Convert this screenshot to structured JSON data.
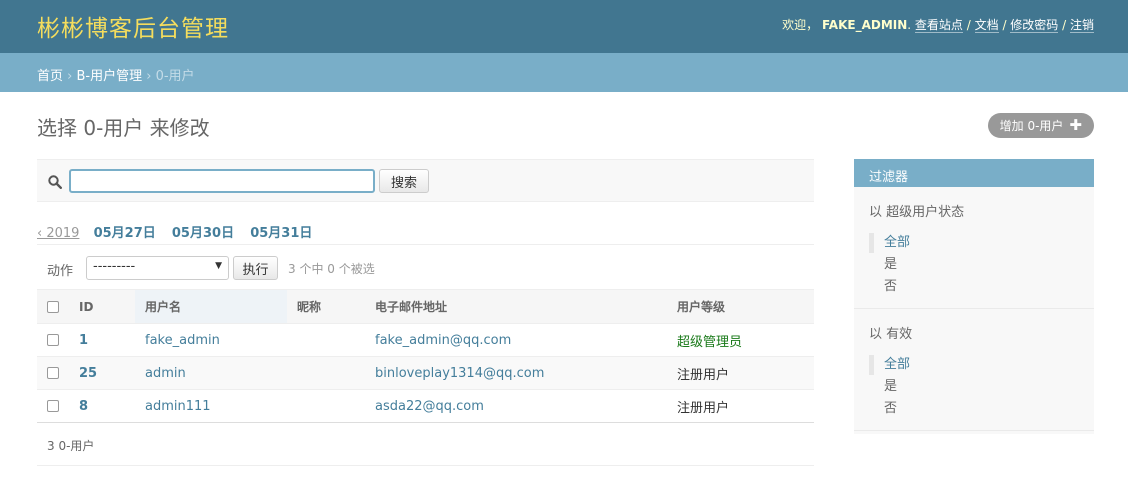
{
  "header": {
    "site_name": "彬彬博客后台管理",
    "welcome": "欢迎，",
    "username": "FAKE_ADMIN",
    "view_site": "查看站点",
    "docs": "文档",
    "change_password": "修改密码",
    "logout": "注销",
    "separator": " / "
  },
  "breadcrumbs": {
    "home": "首页",
    "app": "B-用户管理",
    "current": "0-用户",
    "sep": " › "
  },
  "page": {
    "title": "选择 0-用户 来修改",
    "add_label": "增加 0-用户",
    "add_icon": "plus-icon"
  },
  "search": {
    "value": "",
    "button": "搜索",
    "icon": "search-icon"
  },
  "date_hierarchy": {
    "back": "‹ 2019",
    "dates": [
      "05月27日",
      "05月30日",
      "05月31日"
    ]
  },
  "actions": {
    "label": "动作",
    "selected": "---------",
    "go": "执行",
    "counter": "3 个中 0 个被选"
  },
  "table": {
    "headers": [
      "ID",
      "用户名",
      "昵称",
      "电子邮件地址",
      "用户等级"
    ],
    "rows": [
      {
        "id": "1",
        "username": "fake_admin",
        "nickname": "",
        "email": "fake_admin@qq.com",
        "level": "超级管理员"
      },
      {
        "id": "25",
        "username": "admin",
        "nickname": "",
        "email": "binloveplay1314@qq.com",
        "level": "注册用户"
      },
      {
        "id": "8",
        "username": "admin111",
        "nickname": "",
        "email": "asda22@qq.com",
        "level": "注册用户"
      }
    ]
  },
  "paginator": "3 0-用户",
  "filter": {
    "title": "过滤器",
    "groups": [
      {
        "title": "以 超级用户状态",
        "options": [
          "全部",
          "是",
          "否"
        ]
      },
      {
        "title": "以 有效",
        "options": [
          "全部",
          "是",
          "否"
        ]
      }
    ]
  },
  "colors": {
    "header_bg": "#417690",
    "breadcrumb_bg": "#79aec8",
    "site_name": "#f5dd5d",
    "link": "#447e9b",
    "superuser_level": "#1a7a1a"
  }
}
